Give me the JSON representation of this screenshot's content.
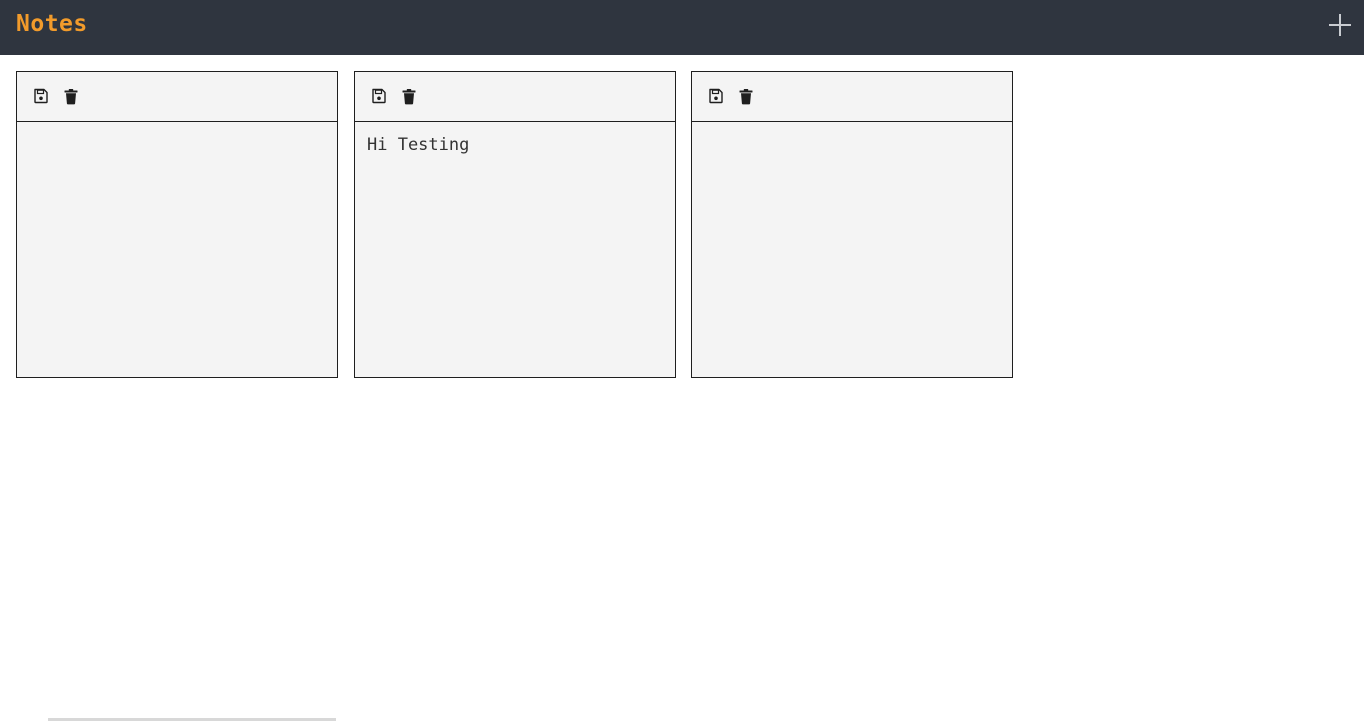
{
  "app": {
    "title": "Notes",
    "add_button_icon": "plus-icon"
  },
  "colors": {
    "header_bg": "#2f353f",
    "title": "#f29b2b",
    "note_bg": "#f4f4f4",
    "note_border": "#1f1f1f"
  },
  "notes": [
    {
      "text": "",
      "icons": [
        "save-icon",
        "trash-icon"
      ]
    },
    {
      "text": "Hi Testing",
      "icons": [
        "save-icon",
        "trash-icon"
      ]
    },
    {
      "text": "",
      "icons": [
        "save-icon",
        "trash-icon"
      ]
    }
  ]
}
